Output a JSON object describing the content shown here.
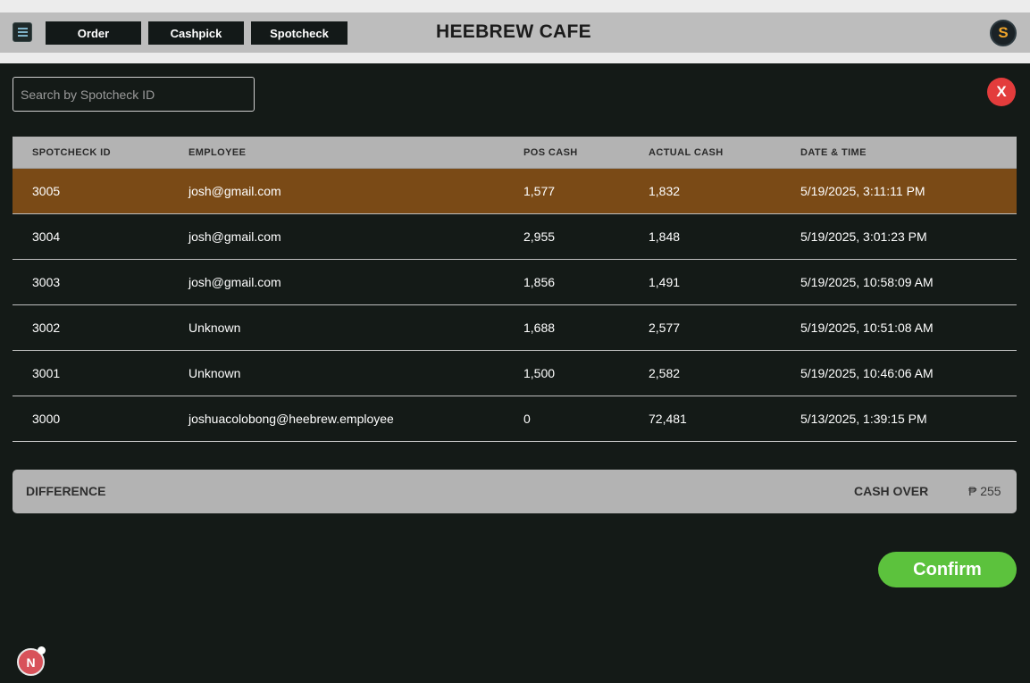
{
  "header": {
    "menu_icon": "hamburger-menu-icon",
    "nav": [
      {
        "label": "Order"
      },
      {
        "label": "Cashpick"
      },
      {
        "label": "Spotcheck"
      }
    ],
    "brand": "HEEBREW CAFE",
    "profile_icon": "s-coin-logo-icon"
  },
  "search": {
    "placeholder": "Search by Spotcheck ID",
    "value": ""
  },
  "close_button": {
    "label": "X"
  },
  "table": {
    "columns": [
      "SPOTCHECK ID",
      "EMPLOYEE",
      "POS CASH",
      "ACTUAL CASH",
      "DATE & TIME"
    ],
    "rows": [
      {
        "id": "3005",
        "employee": "josh@gmail.com",
        "pos_cash": "1,577",
        "actual_cash": "1,832",
        "datetime": "5/19/2025, 3:11:11 PM",
        "selected": true
      },
      {
        "id": "3004",
        "employee": "josh@gmail.com",
        "pos_cash": "2,955",
        "actual_cash": "1,848",
        "datetime": "5/19/2025, 3:01:23 PM",
        "selected": false
      },
      {
        "id": "3003",
        "employee": "josh@gmail.com",
        "pos_cash": "1,856",
        "actual_cash": "1,491",
        "datetime": "5/19/2025, 10:58:09 AM",
        "selected": false
      },
      {
        "id": "3002",
        "employee": "Unknown",
        "pos_cash": "1,688",
        "actual_cash": "2,577",
        "datetime": "5/19/2025, 10:51:08 AM",
        "selected": false
      },
      {
        "id": "3001",
        "employee": "Unknown",
        "pos_cash": "1,500",
        "actual_cash": "2,582",
        "datetime": "5/19/2025, 10:46:06 AM",
        "selected": false
      },
      {
        "id": "3000",
        "employee": "joshuacolobong@heebrew.employee",
        "pos_cash": "0",
        "actual_cash": "72,481",
        "datetime": "5/13/2025, 1:39:15 PM",
        "selected": false
      }
    ]
  },
  "difference": {
    "label": "DIFFERENCE",
    "status": "CASH OVER",
    "amount": "₱ 255"
  },
  "confirm": {
    "label": "Confirm"
  },
  "badge": {
    "label": "N"
  },
  "colors": {
    "background": "#141a17",
    "selected_row": "#7a4a16",
    "confirm_green": "#5cc23d",
    "close_red": "#e33c3c"
  }
}
